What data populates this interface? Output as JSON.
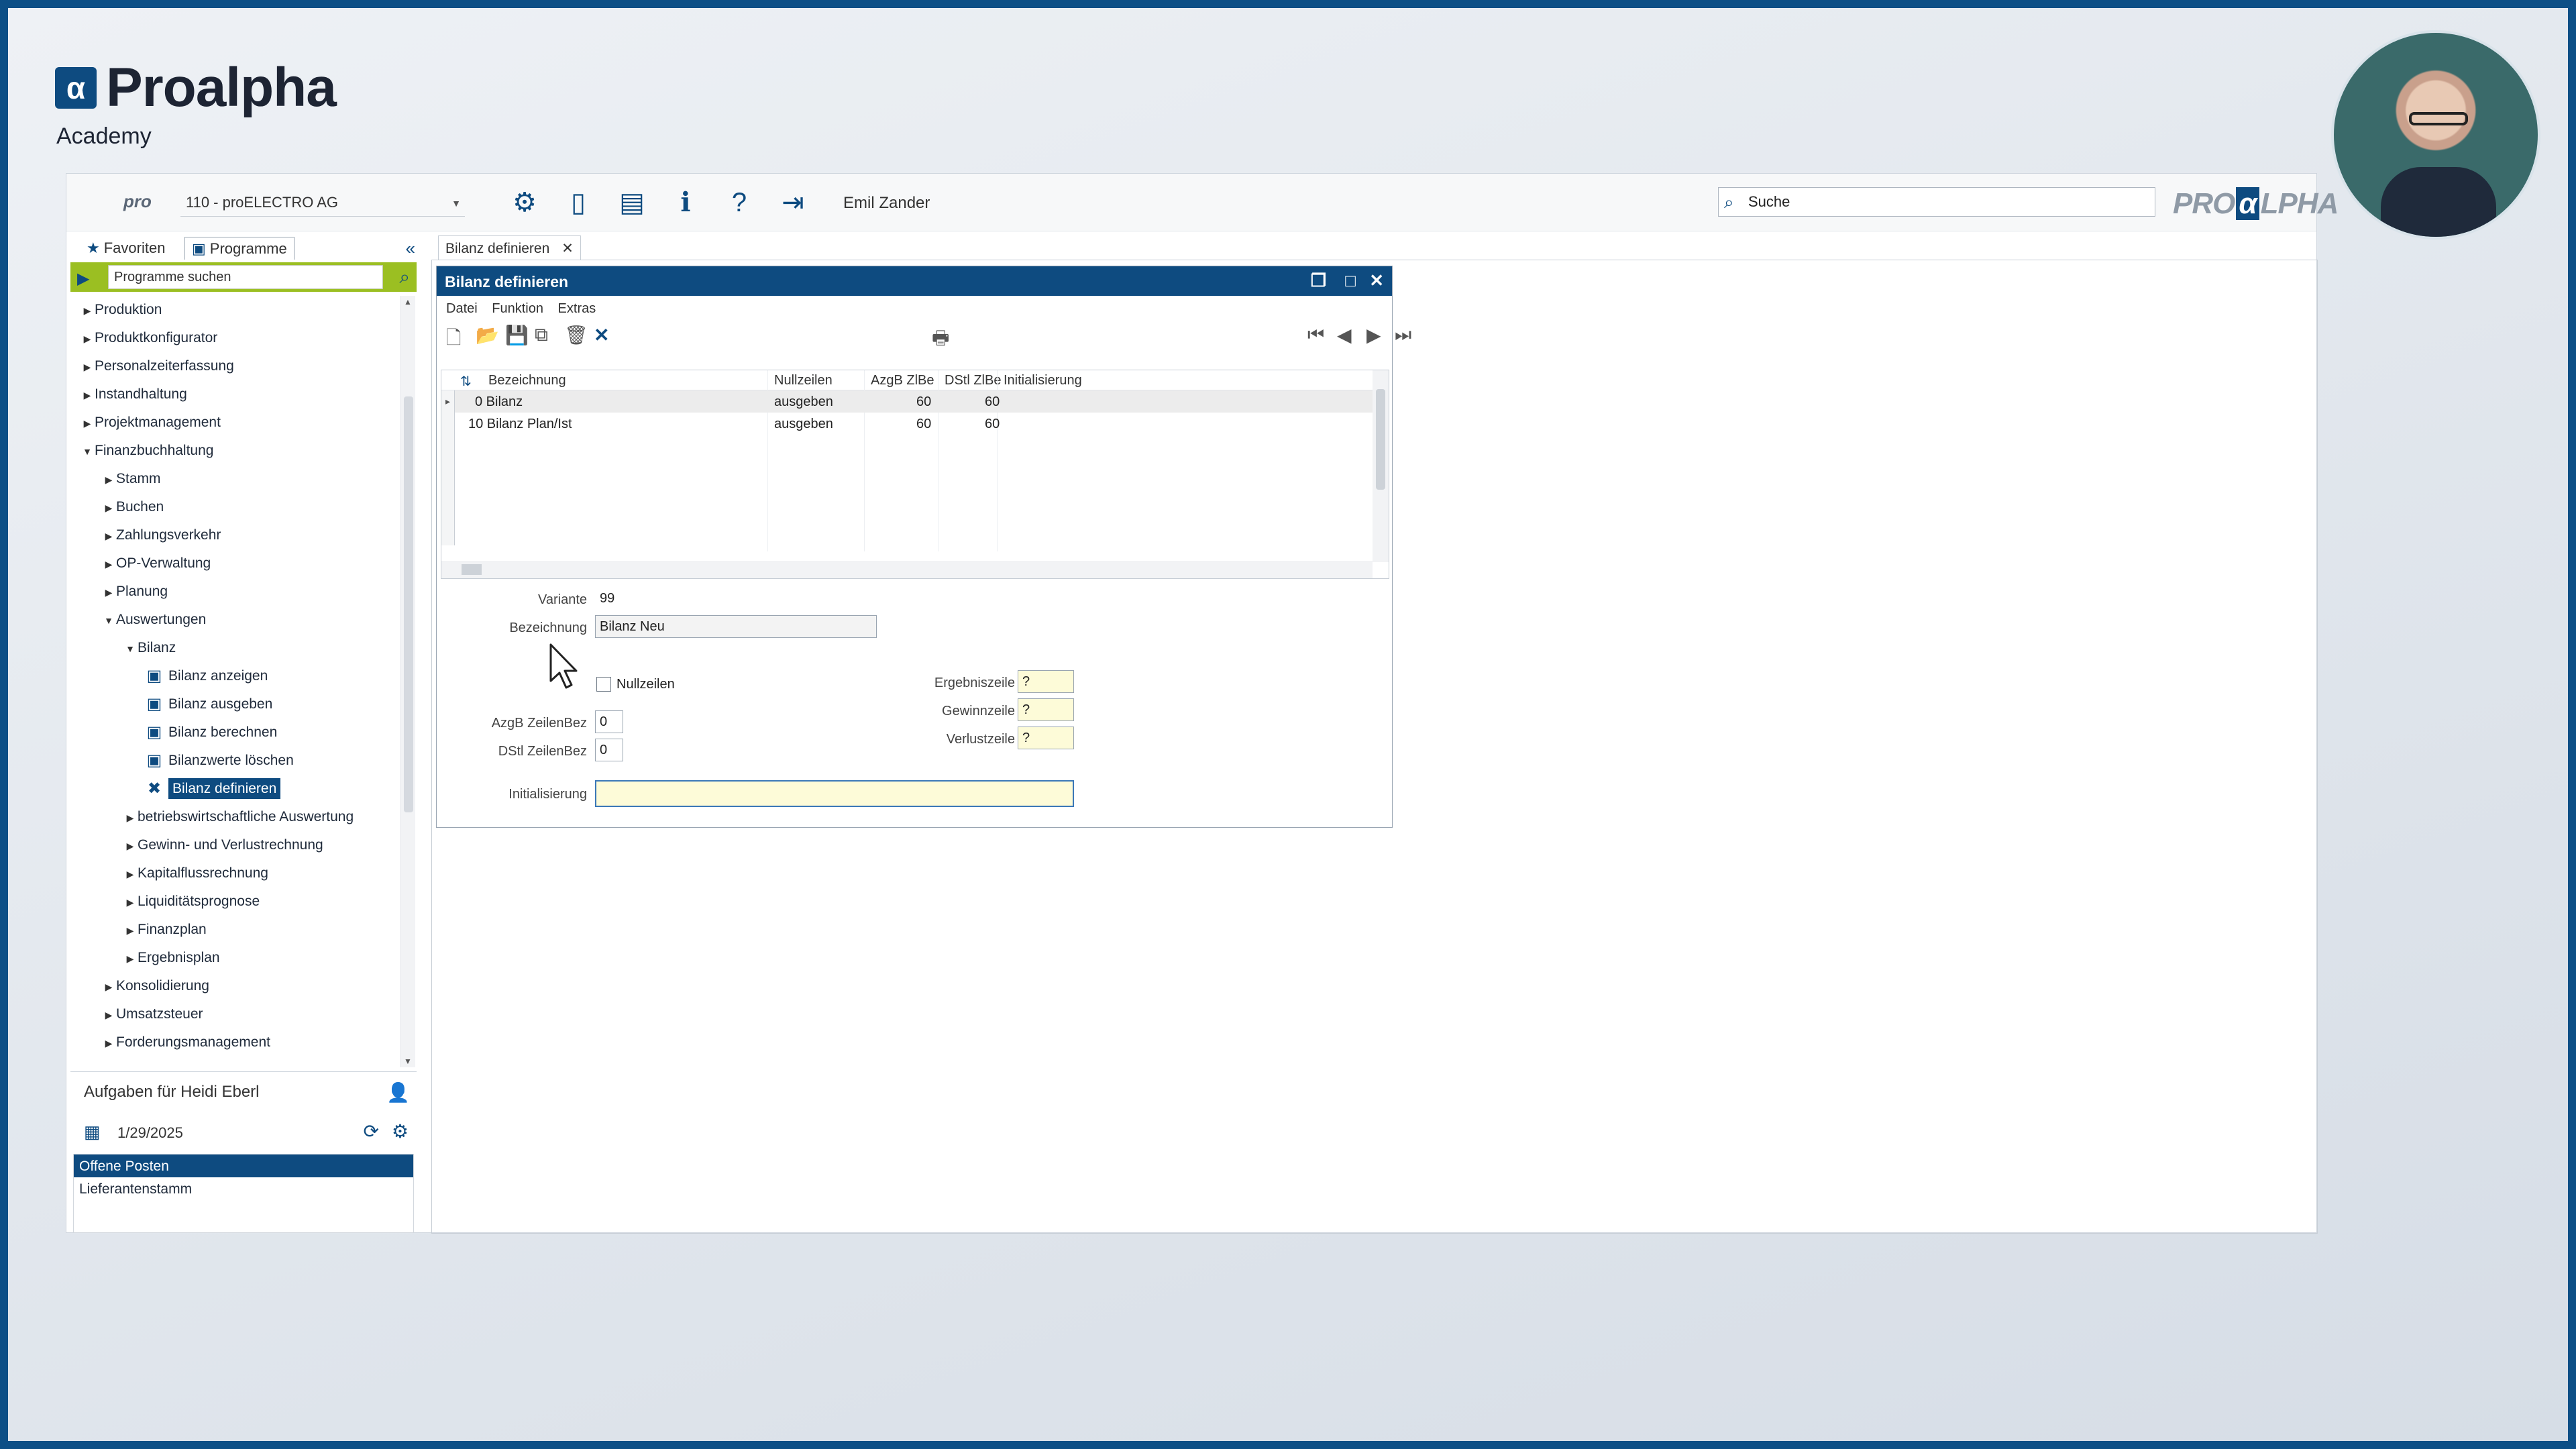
{
  "brand": {
    "mark": "α",
    "name": "Proalpha",
    "sub": "Academy"
  },
  "toolbar": {
    "logo": "pro",
    "company": "110 - proELECTRO AG",
    "user": "Emil Zander",
    "search_placeholder": "Suche",
    "right_logo_left": "PRO",
    "right_logo_mid": "α",
    "right_logo_right": "LPHA"
  },
  "left": {
    "tab_favorites": "Favoriten",
    "tab_programs": "Programme",
    "search_placeholder": "Programme suchen",
    "tree": [
      {
        "label": "Produktion",
        "level": 0,
        "state": "collapsed"
      },
      {
        "label": "Produktkonfigurator",
        "level": 0,
        "state": "collapsed"
      },
      {
        "label": "Personalzeiterfassung",
        "level": 0,
        "state": "collapsed"
      },
      {
        "label": "Instandhaltung",
        "level": 0,
        "state": "collapsed"
      },
      {
        "label": "Projektmanagement",
        "level": 0,
        "state": "collapsed"
      },
      {
        "label": "Finanzbuchhaltung",
        "level": 0,
        "state": "expanded"
      },
      {
        "label": "Stamm",
        "level": 1,
        "state": "collapsed"
      },
      {
        "label": "Buchen",
        "level": 1,
        "state": "collapsed"
      },
      {
        "label": "Zahlungsverkehr",
        "level": 1,
        "state": "collapsed"
      },
      {
        "label": "OP-Verwaltung",
        "level": 1,
        "state": "collapsed"
      },
      {
        "label": "Planung",
        "level": 1,
        "state": "collapsed"
      },
      {
        "label": "Auswertungen",
        "level": 1,
        "state": "expanded"
      },
      {
        "label": "Bilanz",
        "level": 2,
        "state": "expanded"
      },
      {
        "label": "Bilanz anzeigen",
        "level": 3,
        "state": "program"
      },
      {
        "label": "Bilanz ausgeben",
        "level": 3,
        "state": "program"
      },
      {
        "label": "Bilanz berechnen",
        "level": 3,
        "state": "program"
      },
      {
        "label": "Bilanzwerte löschen",
        "level": 3,
        "state": "program"
      },
      {
        "label": "Bilanz definieren",
        "level": 3,
        "state": "selected"
      },
      {
        "label": "betriebswirtschaftliche Auswertung",
        "level": 2,
        "state": "collapsed"
      },
      {
        "label": "Gewinn- und Verlustrechnung",
        "level": 2,
        "state": "collapsed"
      },
      {
        "label": "Kapitalflussrechnung",
        "level": 2,
        "state": "collapsed"
      },
      {
        "label": "Liquiditätsprognose",
        "level": 2,
        "state": "collapsed"
      },
      {
        "label": "Finanzplan",
        "level": 2,
        "state": "collapsed"
      },
      {
        "label": "Ergebnisplan",
        "level": 2,
        "state": "collapsed"
      },
      {
        "label": "Konsolidierung",
        "level": 1,
        "state": "collapsed"
      },
      {
        "label": "Umsatzsteuer",
        "level": 1,
        "state": "collapsed"
      },
      {
        "label": "Forderungsmanagement",
        "level": 1,
        "state": "collapsed"
      }
    ],
    "tasks_title": "Aufgaben für Heidi Eberl",
    "tasks_date": "1/29/2025",
    "tasks": [
      "Offene Posten",
      "Lieferantenstamm"
    ]
  },
  "main": {
    "tab_label": "Bilanz definieren",
    "dialog_title": "Bilanz definieren",
    "menu": [
      "Datei",
      "Funktion",
      "Extras"
    ],
    "grid": {
      "headers": [
        "Bezeichnung",
        "Nullzeilen",
        "AzgB ZlBe",
        "DStl ZlBe",
        "Initialisierung"
      ],
      "rows": [
        [
          "0 Bilanz",
          "ausgeben",
          "60",
          "60",
          ""
        ],
        [
          "10 Bilanz Plan/Ist",
          "ausgeben",
          "60",
          "60",
          ""
        ]
      ]
    },
    "form": {
      "variante_label": "Variante",
      "variante_value": "99",
      "bezeichnung_label": "Bezeichnung",
      "bezeichnung_value": "Bilanz Neu",
      "nullzeilen_label": "Nullzeilen",
      "azgb_label": "AzgB ZeilenBez",
      "azgb_value": "0",
      "dstl_label": "DStl ZeilenBez",
      "dstl_value": "0",
      "ergebnis_label": "Ergebniszeile",
      "ergebnis_value": "?",
      "gewinn_label": "Gewinnzeile",
      "gewinn_value": "?",
      "verlust_label": "Verlustzeile",
      "verlust_value": "?",
      "init_label": "Initialisierung",
      "init_value": ""
    }
  }
}
